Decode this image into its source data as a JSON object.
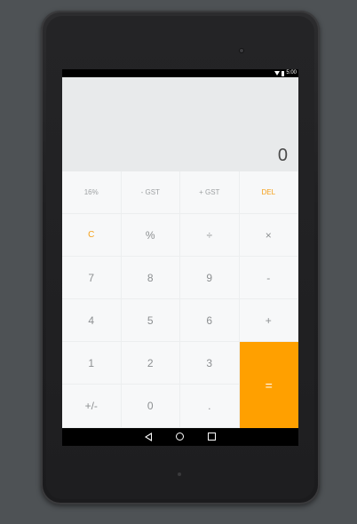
{
  "status": {
    "time": "5:00"
  },
  "display": {
    "value": "0"
  },
  "keys": {
    "pct16": "16%",
    "minus_gst": "- GST",
    "plus_gst": "+ GST",
    "del": "DEL",
    "clear": "C",
    "percent": "%",
    "divide": "÷",
    "multiply": "×",
    "seven": "7",
    "eight": "8",
    "nine": "9",
    "minus": "-",
    "four": "4",
    "five": "5",
    "six": "6",
    "plus": "+",
    "one": "1",
    "two": "2",
    "three": "3",
    "equals": "=",
    "plus_minus": "+/-",
    "zero": "0",
    "decimal": "."
  },
  "colors": {
    "accent": "#ffa000",
    "accent_text": "#f5a01a",
    "display_bg": "#e8eaeb",
    "keypad_bg": "#f7f8f9"
  },
  "icons": {
    "status": [
      "wifi-icon",
      "battery-icon"
    ],
    "nav": [
      "back-icon",
      "home-icon",
      "recents-icon"
    ]
  }
}
